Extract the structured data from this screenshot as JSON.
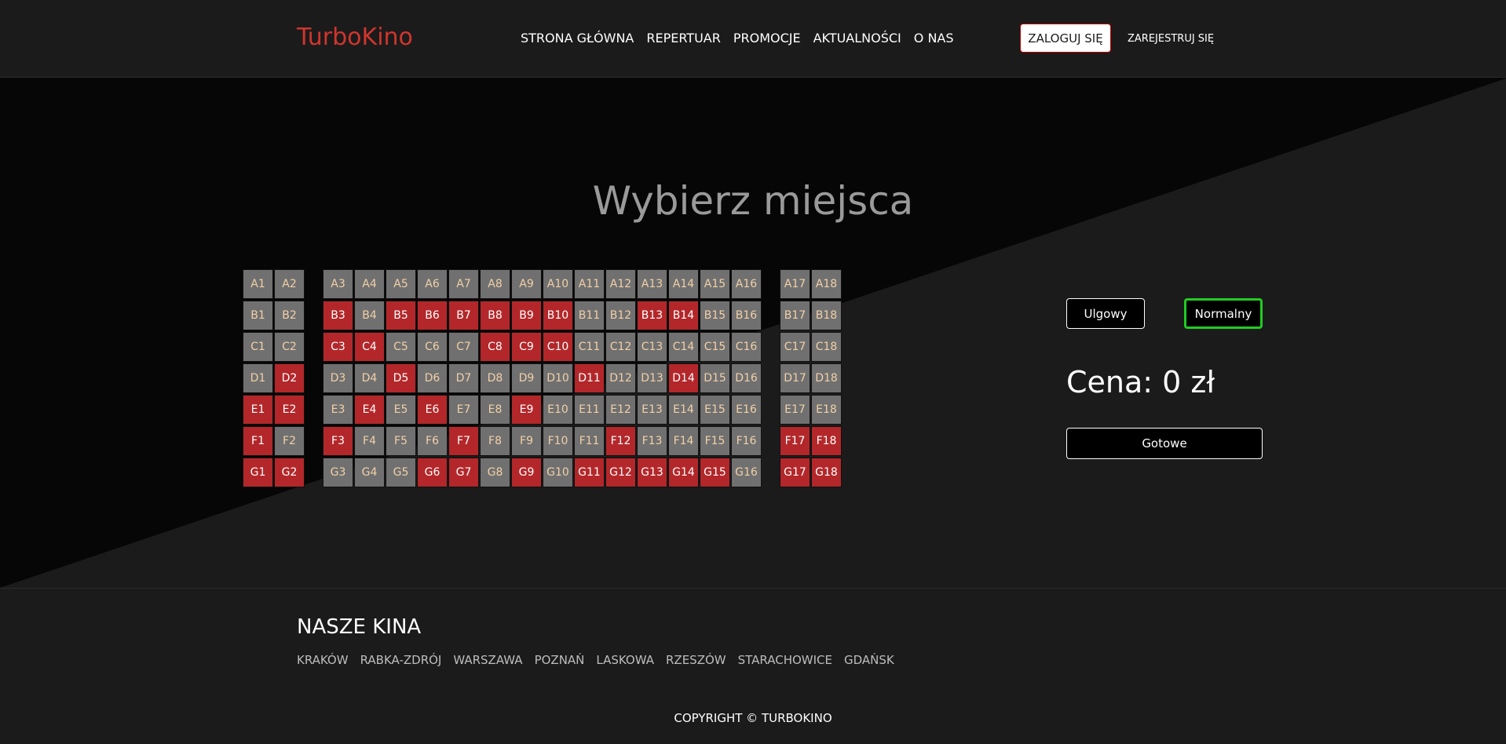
{
  "header": {
    "logo": "TurboKino",
    "nav": [
      "STRONA GŁÓWNA",
      "REPERTUAR",
      "PROMOCJE",
      "AKTUALNOŚCI",
      "O NAS"
    ],
    "login": "ZALOGUJ SIĘ",
    "register": "ZAREJESTRUJ SIĘ"
  },
  "main": {
    "title": "Wybierz miejsca",
    "ticket_types": [
      "Ulgowy",
      "Normalny"
    ],
    "selected_ticket": "Normalny",
    "price": "Cena: 0 zł",
    "done": "Gotowe"
  },
  "seating": {
    "rows": [
      "A",
      "B",
      "C",
      "D",
      "E",
      "F",
      "G"
    ],
    "seats_per_row": 18,
    "taken": [
      "B3",
      "B5",
      "B6",
      "B7",
      "B8",
      "B9",
      "B10",
      "B13",
      "B14",
      "C3",
      "C4",
      "C8",
      "C9",
      "C10",
      "D2",
      "D5",
      "D11",
      "D14",
      "E1",
      "E2",
      "E4",
      "E6",
      "E9",
      "F1",
      "F3",
      "F7",
      "F12",
      "F17",
      "F18",
      "G1",
      "G2",
      "G6",
      "G7",
      "G9",
      "G11",
      "G12",
      "G13",
      "G14",
      "G15",
      "G17",
      "G18"
    ]
  },
  "footer": {
    "heading": "NASZE KINA",
    "cities": [
      "KRAKÓW",
      "RABKA-ZDRÓJ",
      "WARSZAWA",
      "POZNAŃ",
      "LASKOWA",
      "RZESZÓW",
      "STARACHOWICE",
      "GDAŃSK"
    ],
    "copyright": "COPYRIGHT © TURBOKINO"
  },
  "colors": {
    "accent": "#d0352d",
    "seat_free": "#707070",
    "seat_taken": "#b3272a",
    "selected_border": "#22cc22"
  }
}
